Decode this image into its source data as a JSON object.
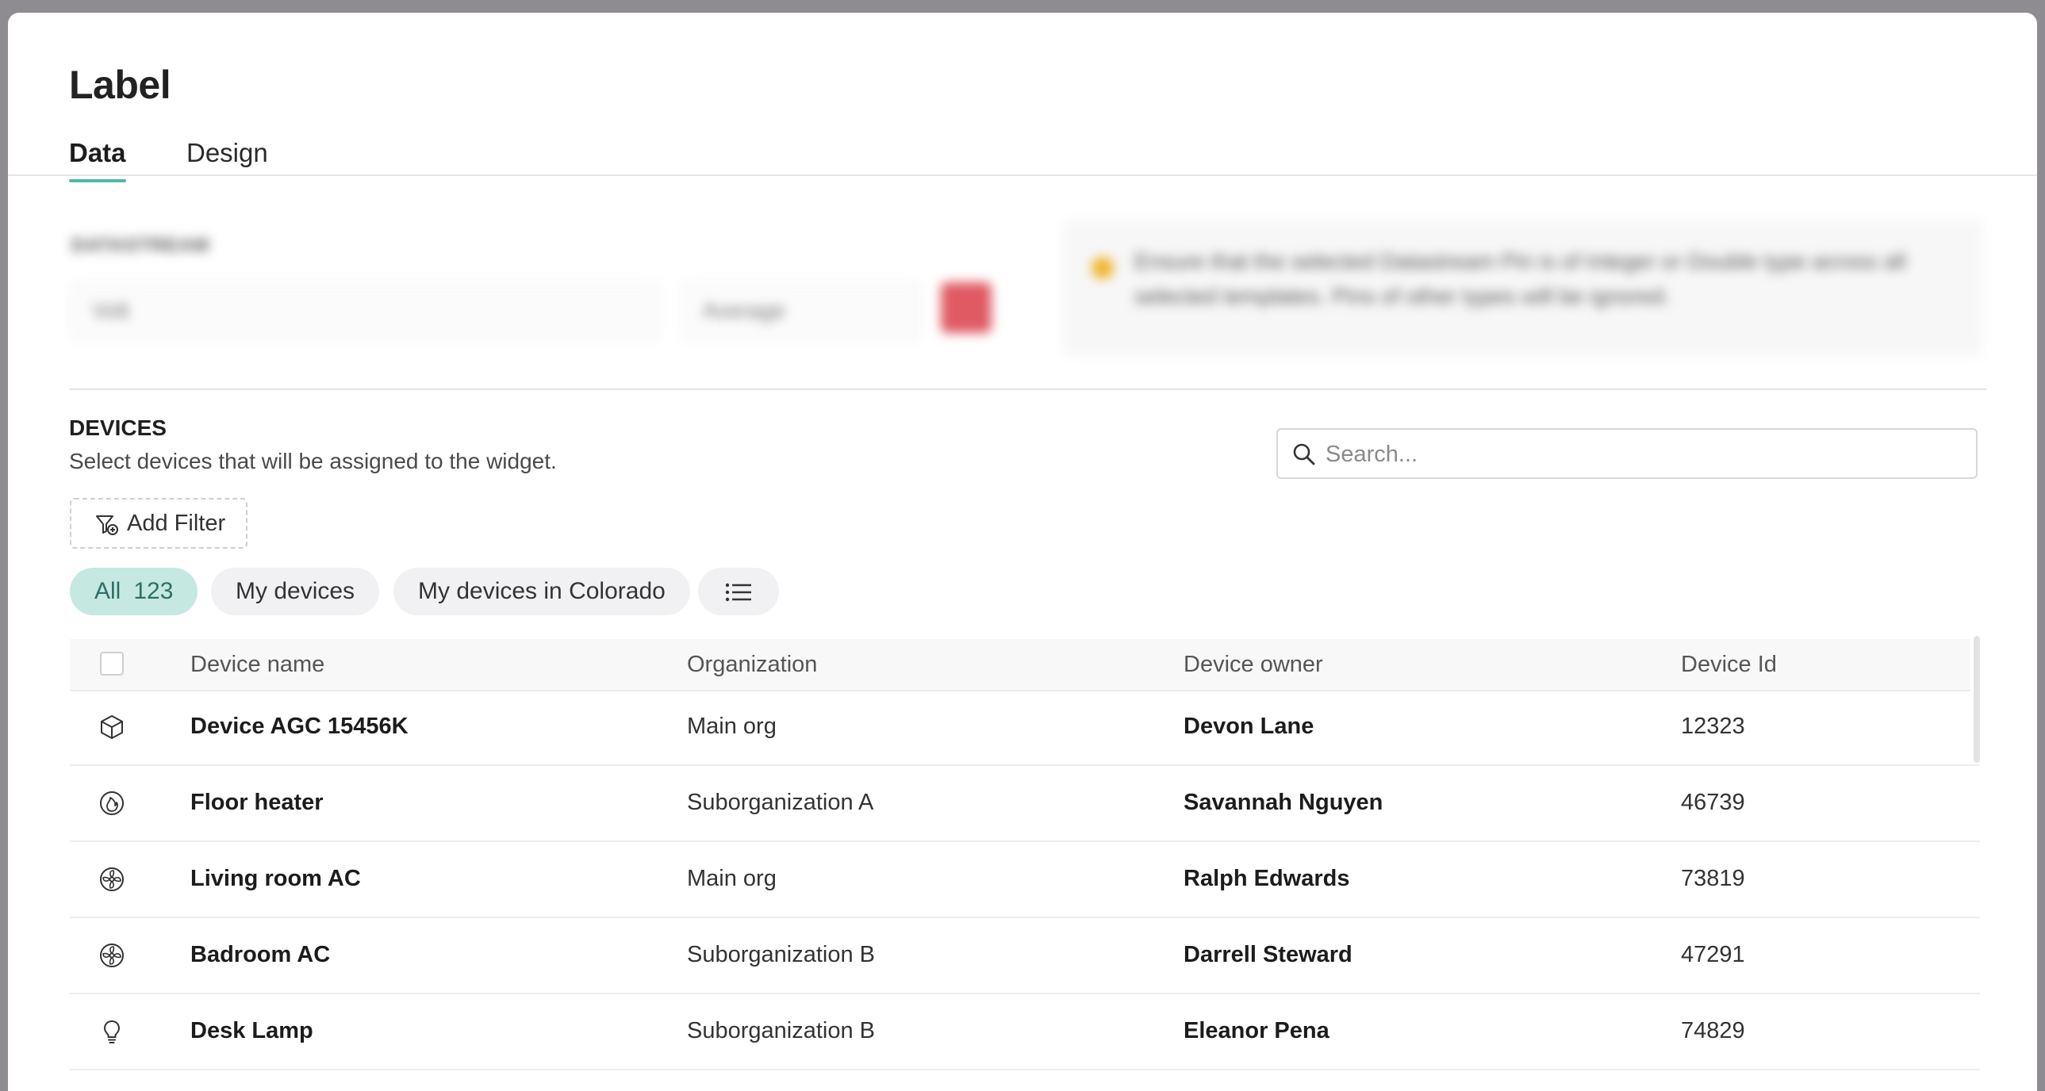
{
  "dialog": {
    "title": "Label",
    "tabs": [
      {
        "label": "Data",
        "active": true
      },
      {
        "label": "Design",
        "active": false
      }
    ]
  },
  "datastream": {
    "label": "DATASTREAM",
    "select_value": "Volt",
    "aggregation_value": "Average",
    "note": "Ensure that the selected Datastream Pin is of Integer or Double type across all selected templates. Pins of other types will be ignored."
  },
  "devices": {
    "title": "DEVICES",
    "subtitle": "Select devices that will be assigned to the widget.",
    "search_placeholder": "Search...",
    "add_filter_label": "Add Filter",
    "chips": [
      {
        "label": "All",
        "count": "123",
        "active": true
      },
      {
        "label": "My devices",
        "active": false
      },
      {
        "label": "My devices in Colorado",
        "active": false
      }
    ],
    "columns": [
      "Device name",
      "Organization",
      "Device owner",
      "Device Id"
    ],
    "rows": [
      {
        "icon": "cube-icon",
        "name": "Device AGC 15456K",
        "organization": "Main org",
        "owner": "Devon Lane",
        "id": "12323"
      },
      {
        "icon": "flame-icon",
        "name": "Floor heater",
        "organization": "Suborganization A",
        "owner": "Savannah Nguyen",
        "id": "46739"
      },
      {
        "icon": "fan-icon",
        "name": "Living room AC",
        "organization": "Main org",
        "owner": "Ralph Edwards",
        "id": "73819"
      },
      {
        "icon": "fan-icon",
        "name": "Badroom AC",
        "organization": "Suborganization B",
        "owner": "Darrell Steward",
        "id": "47291"
      },
      {
        "icon": "lightbulb-icon",
        "name": "Desk Lamp",
        "organization": "Suborganization B",
        "owner": "Eleanor Pena",
        "id": "74829"
      }
    ]
  },
  "colors": {
    "accent": "#4fb8a5",
    "chip_active_bg": "#c5e8e1",
    "delete_red": "#e05a64",
    "warning": "#f0b429"
  }
}
